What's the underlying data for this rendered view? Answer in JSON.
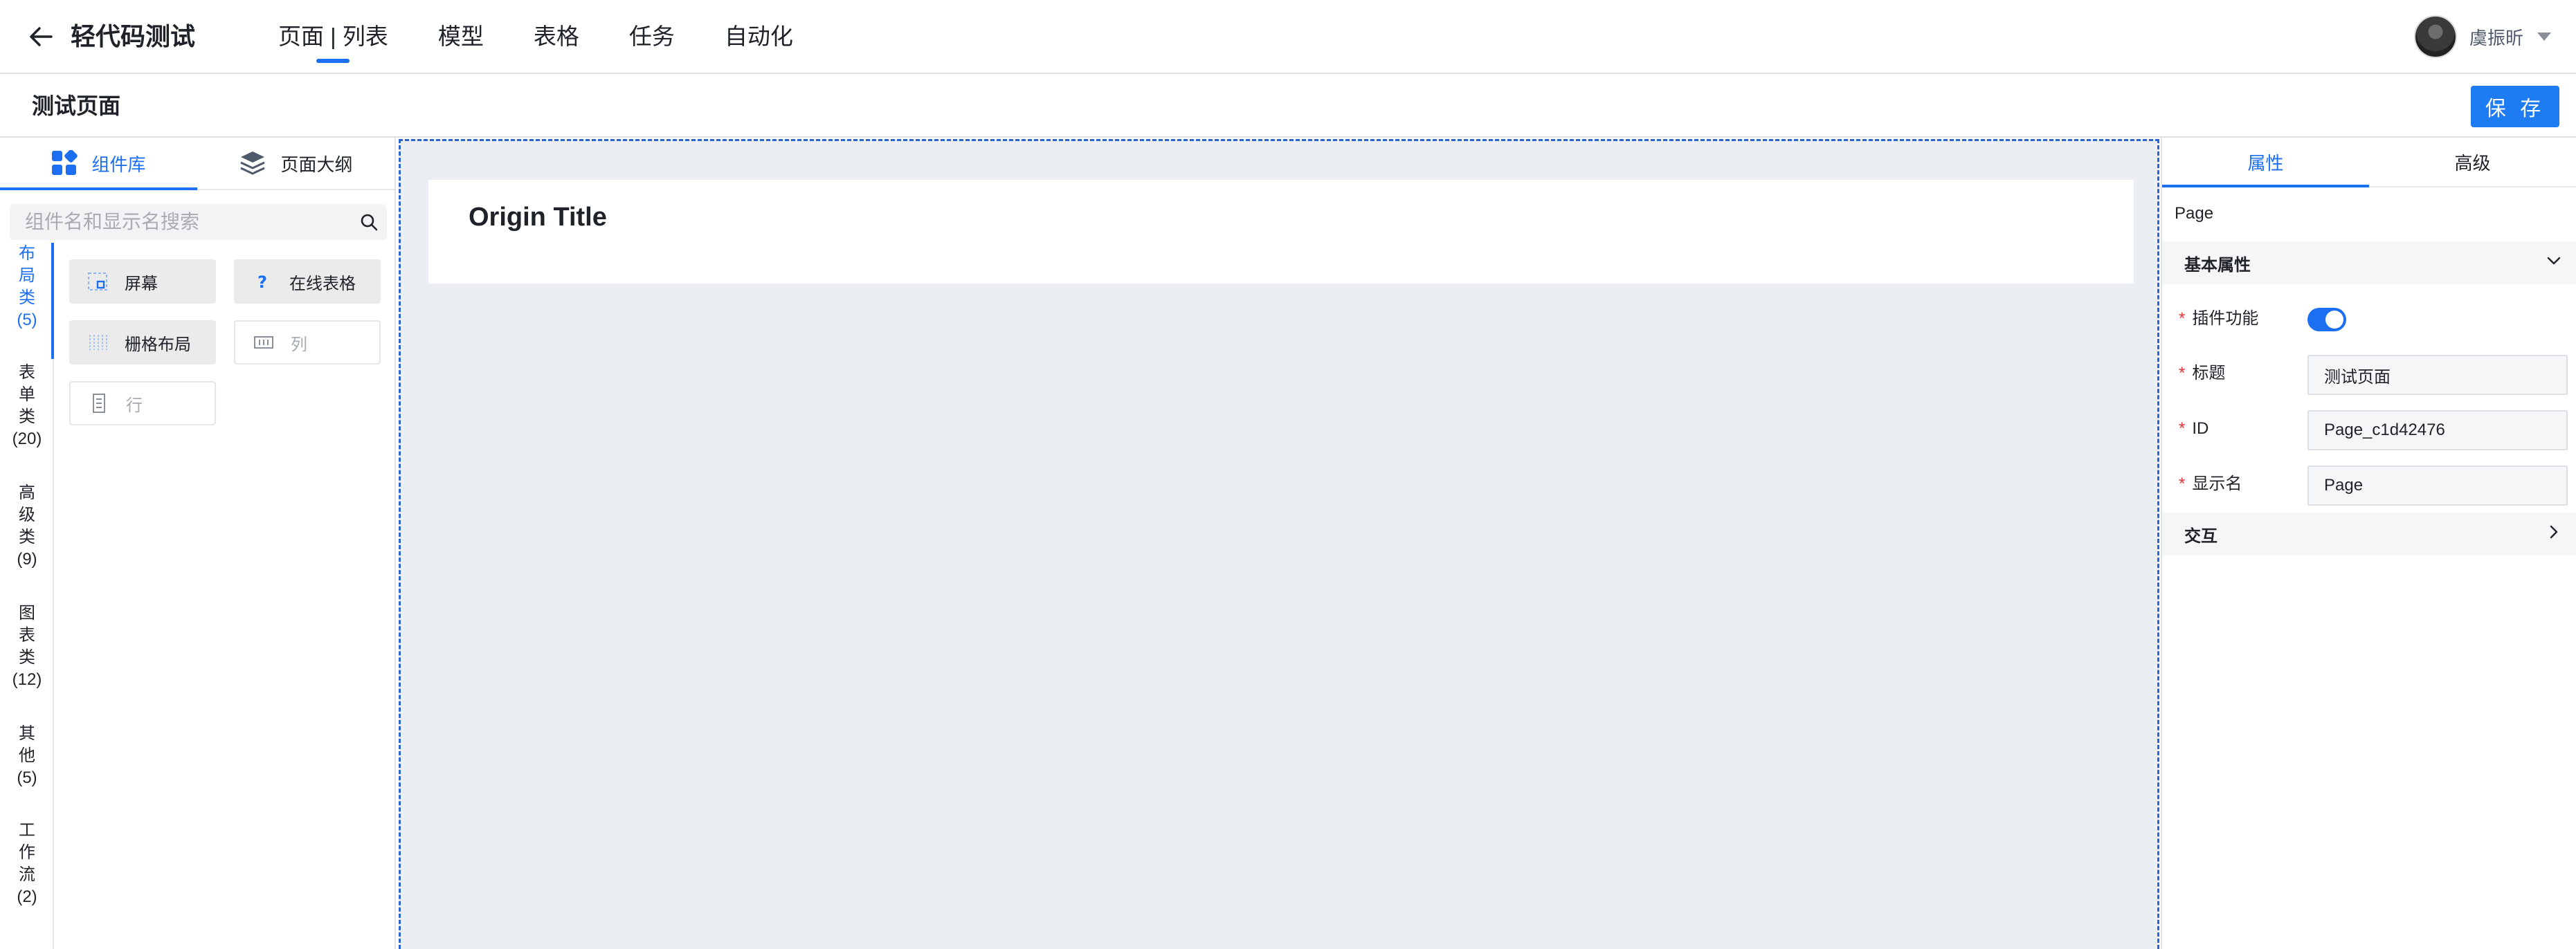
{
  "topbar": {
    "app_title": "轻代码测试",
    "nav": [
      {
        "label": "页面 | 列表",
        "active": true
      },
      {
        "label": "模型",
        "active": false
      },
      {
        "label": "表格",
        "active": false
      },
      {
        "label": "任务",
        "active": false
      },
      {
        "label": "自动化",
        "active": false
      }
    ],
    "user_name": "虞振昕"
  },
  "subheader": {
    "page_name": "测试页面",
    "save_label": "保 存"
  },
  "left_panel": {
    "tabs": [
      {
        "label": "组件库",
        "icon": "grid-apps-icon",
        "active": true
      },
      {
        "label": "页面大纲",
        "icon": "layers-icon",
        "active": false
      }
    ],
    "search_placeholder": "组件名和显示名搜索",
    "categories": [
      {
        "chars": [
          "布",
          "局",
          "类"
        ],
        "count": "(5)",
        "active": true
      },
      {
        "chars": [
          "表",
          "单",
          "类"
        ],
        "count": "(20)",
        "active": false
      },
      {
        "chars": [
          "高",
          "级",
          "类"
        ],
        "count": "(9)",
        "active": false
      },
      {
        "chars": [
          "图",
          "表",
          "类"
        ],
        "count": "(12)",
        "active": false
      },
      {
        "chars": [
          "其",
          "他"
        ],
        "count": "(5)",
        "active": false
      },
      {
        "chars": [
          "工",
          "作",
          "流"
        ],
        "count": "(2)",
        "active": false
      }
    ],
    "components": [
      {
        "label": "屏幕",
        "icon": "screen-icon"
      },
      {
        "label": "在线表格",
        "icon": "question-icon"
      },
      {
        "label": "栅格布局",
        "icon": "grid-layout-icon"
      },
      {
        "label": "列",
        "icon": "column-icon"
      },
      {
        "label": "行",
        "icon": "row-icon"
      }
    ]
  },
  "canvas": {
    "origin_title": "Origin Title"
  },
  "right_panel": {
    "tabs": [
      {
        "label": "属性",
        "active": true
      },
      {
        "label": "高级",
        "active": false
      }
    ],
    "component_type": "Page",
    "basic_section": "基本属性",
    "props": {
      "plugin_label": "插件功能",
      "plugin_enabled": true,
      "title_label": "标题",
      "title_value": "测试页面",
      "id_label": "ID",
      "id_value": "Page_c1d42476",
      "display_label": "显示名",
      "display_value": "Page"
    },
    "interaction_section": "交互"
  },
  "colors": {
    "accent": "#1d6ff2",
    "required": "#e8313a",
    "canvas_bg": "#ebeef3",
    "selection_border": "#2a65cf"
  }
}
